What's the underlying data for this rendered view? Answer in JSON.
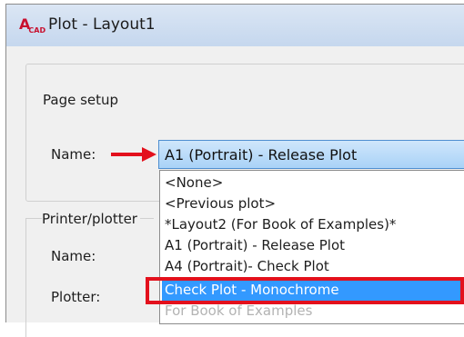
{
  "window": {
    "title": "Plot - Layout1"
  },
  "page_setup": {
    "group_label": "Page setup",
    "name_label": "Name:",
    "selected_value": "A1 (Portrait) - Release Plot",
    "options": [
      {
        "label": "<None>",
        "state": "normal"
      },
      {
        "label": "<Previous plot>",
        "state": "normal"
      },
      {
        "label": "*Layout2 (For Book of Examples)*",
        "state": "normal"
      },
      {
        "label": "A1 (Portrait) - Release Plot",
        "state": "normal"
      },
      {
        "label": "A4 (Portrait)- Check Plot",
        "state": "normal"
      },
      {
        "label": "Check Plot - Monochrome",
        "state": "selected"
      },
      {
        "label": "For Book of Examples",
        "state": "faded"
      }
    ]
  },
  "printer_plotter": {
    "group_label": "Printer/plotter",
    "name_label": "Name:",
    "plotter_label": "Plotter:"
  },
  "colors": {
    "highlight": "#3399ff",
    "annotation_red": "#e3101c"
  }
}
